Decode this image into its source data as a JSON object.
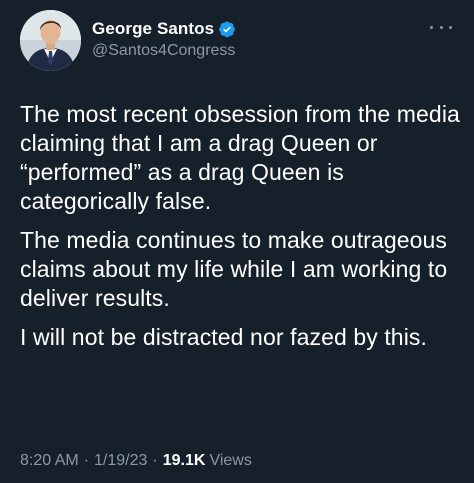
{
  "author": {
    "display_name": "George Santos",
    "handle": "@Santos4Congress",
    "verified_color": "#1d9bf0"
  },
  "tweet": {
    "paragraphs": [
      "The most recent obsession from the media claiming that I am a drag Queen or “performed” as a drag Queen is categorically false.",
      "The media continues to make outrageous claims about my life while I am working to deliver results.",
      "I will not be distracted nor fazed by this."
    ]
  },
  "meta": {
    "time": "8:20 AM",
    "date": "1/19/23",
    "separator": "·",
    "views_count": "19.1K",
    "views_label": "Views"
  },
  "icons": {
    "more": "more-options-icon",
    "verified": "verified-badge-icon"
  },
  "colors": {
    "background": "#15202b",
    "text": "#ffffff",
    "secondary": "#8b98a5"
  }
}
